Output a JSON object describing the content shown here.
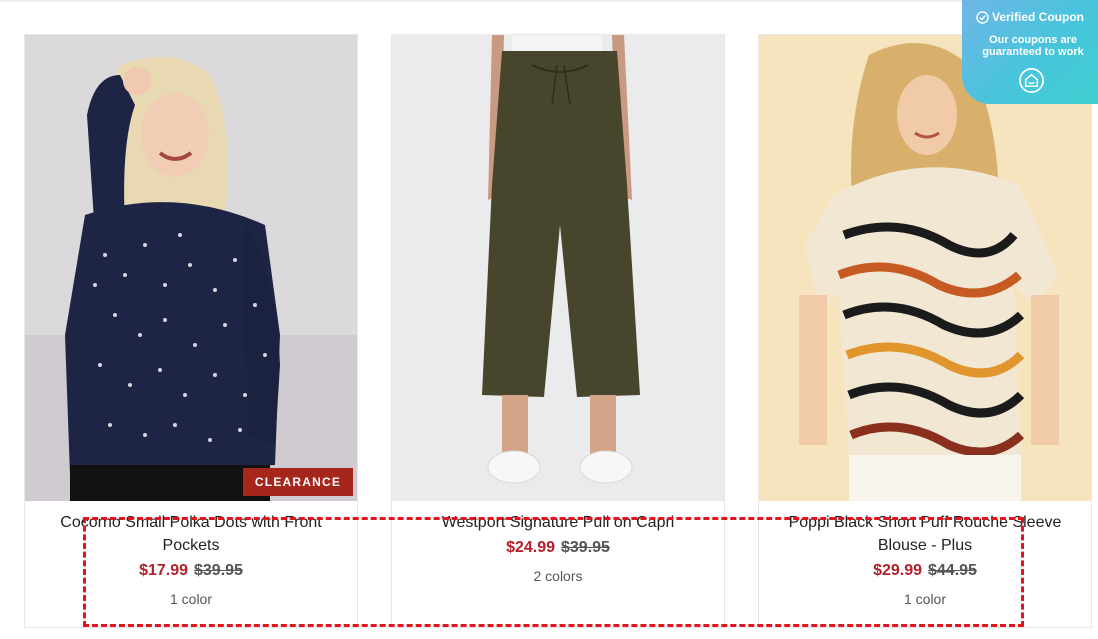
{
  "products": [
    {
      "name": "Cocorno Small Polka Dots with Front Pockets",
      "sale_price": "$17.99",
      "original_price": "$39.95",
      "colors": "1 color",
      "badge": "CLEARANCE"
    },
    {
      "name": "Westport Signature Pull on Capri",
      "sale_price": "$24.99",
      "original_price": "$39.95",
      "colors": "2 colors"
    },
    {
      "name": "Poppi Black Short Puff Rouche Sleeve Blouse - Plus",
      "sale_price": "$29.99",
      "original_price": "$44.95",
      "colors": "1 color"
    }
  ],
  "coupon_widget": {
    "title": "Verified Coupon",
    "subtitle": "Our coupons are guaranteed to work",
    "icons": [
      "check-circle-icon",
      "coupon-brand-logo-icon"
    ]
  },
  "colors": {
    "sale_price": "#b3202a",
    "badge_bg": "#a6261c",
    "highlight_box": "#e0151d",
    "coupon_gradient_start": "#6fb6e6",
    "coupon_gradient_end": "#3fcfcf"
  }
}
